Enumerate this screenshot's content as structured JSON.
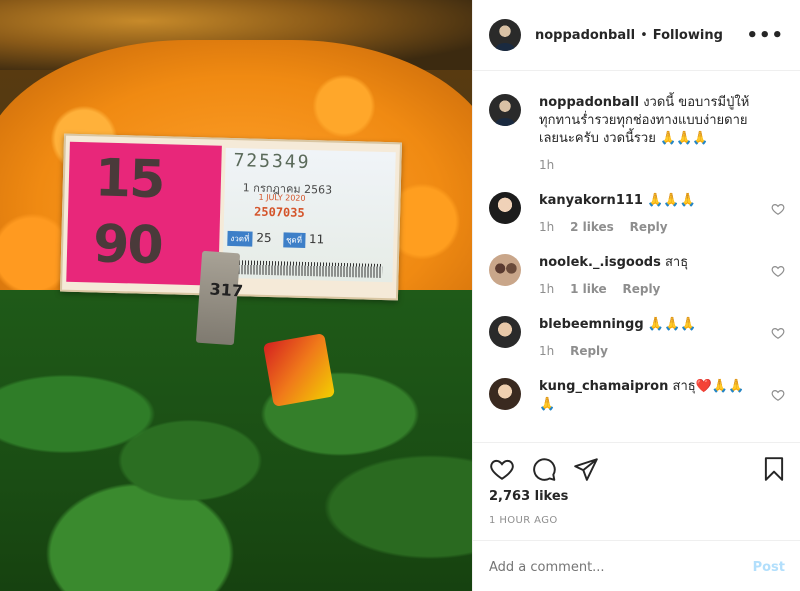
{
  "post": {
    "username": "noppadonball",
    "follow_status": "Following",
    "more_label": "•••"
  },
  "ticket": {
    "prize_top": "15",
    "prize_bottom": "90",
    "number": "725349",
    "date_th": "1 กรกฎาคม 2563",
    "date_en": "1 JULY 2020",
    "serial": "2507035",
    "set_label": "งวดที่",
    "set_value": "25",
    "group_label": "ชุดที่",
    "group_value": "11",
    "stake_text": "317"
  },
  "caption": {
    "username": "noppadonball",
    "text": "งวดนี้ ขอบารมีปู่ให้ ทุกทานร่ำรวยทุกช่องทางแบบง่ายดายเลยนะครับ งวดนี้รวย 🙏🙏🙏",
    "time": "1h"
  },
  "comments": [
    {
      "username": "kanyakorn111",
      "text": "🙏🙏🙏",
      "time": "1h",
      "likes": "2 likes",
      "reply": "Reply"
    },
    {
      "username": "noolek._.isgoods",
      "text": "สาธุ",
      "time": "1h",
      "likes": "1 like",
      "reply": "Reply"
    },
    {
      "username": "blebeemningg",
      "text": "🙏🙏🙏",
      "time": "1h",
      "likes": "",
      "reply": "Reply"
    },
    {
      "username": "kung_chamaipron",
      "text": "สาธุ❤️🙏🙏🙏",
      "time": "",
      "likes": "",
      "reply": ""
    }
  ],
  "actions": {
    "likes_count": "2,763 likes",
    "posted_ago": "1 HOUR AGO",
    "comment_placeholder": "Add a comment...",
    "post_label": "Post"
  },
  "icons": {
    "like": "heart-icon",
    "comment": "comment-icon",
    "share": "share-icon",
    "save": "bookmark-icon"
  }
}
